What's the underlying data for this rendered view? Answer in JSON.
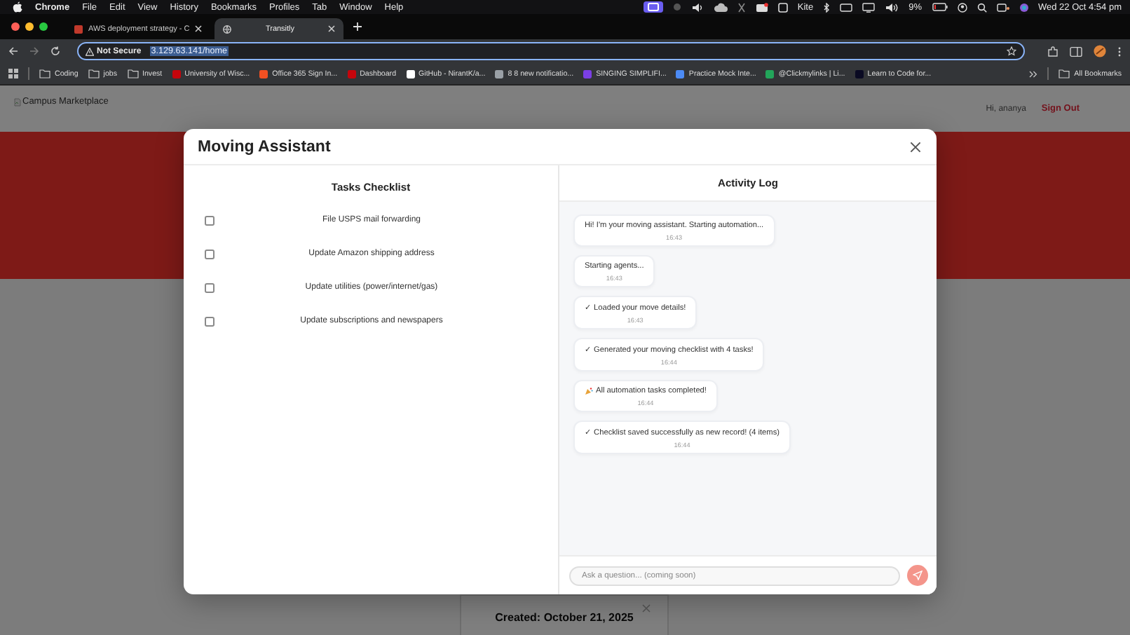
{
  "menubar": {
    "app": "Chrome",
    "menus": [
      "File",
      "Edit",
      "View",
      "History",
      "Bookmarks",
      "Profiles",
      "Tab",
      "Window",
      "Help"
    ],
    "kite": "Kite",
    "battery": "9%",
    "clock": "Wed 22 Oct  4:54 pm"
  },
  "tabs": [
    {
      "title": "AWS deployment strategy - C",
      "selected": false
    },
    {
      "title": "Transitly",
      "selected": true
    }
  ],
  "address": {
    "security": "Not Secure",
    "url": "3.129.63.141/home"
  },
  "bookmarks": [
    {
      "kind": "folder",
      "label": "Coding"
    },
    {
      "kind": "folder",
      "label": "jobs"
    },
    {
      "kind": "folder",
      "label": "Invest"
    },
    {
      "kind": "site",
      "label": "University of Wisc...",
      "color": "#c5050c"
    },
    {
      "kind": "site",
      "label": "Office 365 Sign In...",
      "color": "#f25022"
    },
    {
      "kind": "site",
      "label": "Dashboard",
      "color": "#c5050c"
    },
    {
      "kind": "site",
      "label": "GitHub - NirantK/a...",
      "color": "#ffffff"
    },
    {
      "kind": "site",
      "label": "8 8 new notificatio...",
      "color": "#9aa0a6"
    },
    {
      "kind": "site",
      "label": "SINGING SIMPLIFI...",
      "color": "#7b3fe4"
    },
    {
      "kind": "site",
      "label": "Practice Mock Inte...",
      "color": "#4c8bf5"
    },
    {
      "kind": "site",
      "label": "@Clickmylinks | Li...",
      "color": "#22a55a"
    },
    {
      "kind": "site",
      "label": "Learn to Code for...",
      "color": "#0a0a23"
    }
  ],
  "all_bookmarks": "All Bookmarks",
  "site": {
    "logo_alt": "Campus Marketplace",
    "greeting": "Hi, ananya",
    "sign_out": "Sign Out",
    "card_text": "Created: October 21, 2025"
  },
  "modal": {
    "title": "Moving Assistant",
    "tasks_title": "Tasks Checklist",
    "tasks": [
      {
        "label": "File USPS mail forwarding",
        "checked": false
      },
      {
        "label": "Update Amazon shipping address",
        "checked": false
      },
      {
        "label": "Update utilities (power/internet/gas)",
        "checked": false
      },
      {
        "label": "Update subscriptions and newspapers",
        "checked": false
      }
    ],
    "log_title": "Activity Log",
    "log": [
      {
        "kind": "plain",
        "text": "Hi! I'm your moving assistant. Starting automation...",
        "time": "16:43"
      },
      {
        "kind": "plain",
        "text": "Starting agents...",
        "time": "16:43"
      },
      {
        "kind": "plain",
        "text": "✓ Loaded your move details!",
        "time": "16:43"
      },
      {
        "kind": "plain",
        "text": "✓ Generated your moving checklist with 4 tasks!",
        "time": "16:44"
      },
      {
        "kind": "celebration",
        "text": "All automation tasks completed!",
        "time": "16:44"
      },
      {
        "kind": "plain",
        "text": "✓ Checklist saved successfully as new record! (4 items)",
        "time": "16:44"
      }
    ],
    "input": {
      "placeholder": "Ask a question... (coming soon)"
    }
  }
}
